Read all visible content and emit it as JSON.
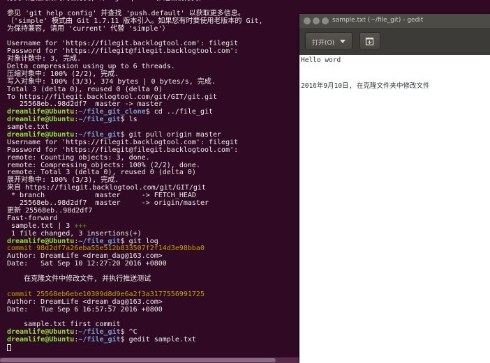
{
  "terminal": {
    "lines": [
      [
        {
          "t": "text",
          "v": "分支到远程无敌的同名分支, 即 'git push' 推送当前分支。"
        }
      ],
      [
        {
          "t": "text",
          "v": ""
        }
      ],
      [
        {
          "t": "text",
          "v": "参见 'git help config' 并查找 'push.default' 以获取更多信息。"
        }
      ],
      [
        {
          "t": "text",
          "v": "（'simple' 模式由 Git 1.7.11 版本引入。如果您有时要使用老版本的 Git,"
        }
      ],
      [
        {
          "t": "text",
          "v": "为保持兼容, 请用 'current' 代替 'simple'）"
        }
      ],
      [
        {
          "t": "text",
          "v": ""
        }
      ],
      [
        {
          "t": "text",
          "v": "Username for 'https://filegit.backlogtool.com': filegit"
        }
      ],
      [
        {
          "t": "text",
          "v": "Password for 'https://filegit@filegit.backlogtool.com':"
        }
      ],
      [
        {
          "t": "text",
          "v": "对象计数中: 3, 完成."
        }
      ],
      [
        {
          "t": "text",
          "v": "Delta compression using up to 6 threads."
        }
      ],
      [
        {
          "t": "text",
          "v": "压缩对象中: 100% (2/2), 完成."
        }
      ],
      [
        {
          "t": "text",
          "v": "写入对象中: 100% (3/3), 374 bytes | 0 bytes/s, 完成."
        }
      ],
      [
        {
          "t": "text",
          "v": "Total 3 (delta 0), reused 0 (delta 0)"
        }
      ],
      [
        {
          "t": "text",
          "v": "To https://filegit.backlogtool.com/git/GIT/git.git"
        }
      ],
      [
        {
          "t": "text",
          "v": "   25568eb..98d2df7  master -> master"
        }
      ],
      [
        {
          "t": "prompt",
          "v": "dreamlife@Ubuntu"
        },
        {
          "t": "sep",
          "v": ":"
        },
        {
          "t": "path",
          "v": "~/file_git_clone"
        },
        {
          "t": "text",
          "v": "$ cd ../file_git"
        }
      ],
      [
        {
          "t": "prompt",
          "v": "dreamlife@Ubuntu"
        },
        {
          "t": "sep",
          "v": ":"
        },
        {
          "t": "path",
          "v": "~/file_git"
        },
        {
          "t": "text",
          "v": "$ ls"
        }
      ],
      [
        {
          "t": "text",
          "v": "sample.txt"
        }
      ],
      [
        {
          "t": "prompt",
          "v": "dreamlife@Ubuntu"
        },
        {
          "t": "sep",
          "v": ":"
        },
        {
          "t": "path",
          "v": "~/file_git"
        },
        {
          "t": "text",
          "v": "$ git pull origin master"
        }
      ],
      [
        {
          "t": "text",
          "v": "Username for 'https://filegit.backlogtool.com': filegit"
        }
      ],
      [
        {
          "t": "text",
          "v": "Password for 'https://filegit@filegit.backlogtool.com':"
        }
      ],
      [
        {
          "t": "text",
          "v": "remote: Counting objects: 3, done."
        }
      ],
      [
        {
          "t": "text",
          "v": "remote: Compressing objects: 100% (2/2), done."
        }
      ],
      [
        {
          "t": "text",
          "v": "remote: Total 3 (delta 0), reused 0 (delta 0)"
        }
      ],
      [
        {
          "t": "text",
          "v": "展开对象中: 100% (3/3), 完成."
        }
      ],
      [
        {
          "t": "text",
          "v": "来自 https://filegit.backlogtool.com/git/GIT/git"
        }
      ],
      [
        {
          "t": "text",
          "v": " * branch            master     -> FETCH_HEAD"
        }
      ],
      [
        {
          "t": "text",
          "v": "   25568eb..98d2df7  master     -> origin/master"
        }
      ],
      [
        {
          "t": "text",
          "v": "更新 25568eb..98d2df7"
        }
      ],
      [
        {
          "t": "text",
          "v": "Fast-forward"
        }
      ],
      [
        {
          "t": "text",
          "v": " sample.txt | 3 "
        },
        {
          "t": "green",
          "v": "+++"
        }
      ],
      [
        {
          "t": "text",
          "v": " 1 file changed, 3 insertions(+)"
        }
      ],
      [
        {
          "t": "prompt",
          "v": "dreamlife@Ubuntu"
        },
        {
          "t": "sep",
          "v": ":"
        },
        {
          "t": "path",
          "v": "~/file_git"
        },
        {
          "t": "text",
          "v": "$ git log"
        }
      ],
      [
        {
          "t": "yellow",
          "v": "commit 98d2df7a26eba55e512b833507f2f14d3e98bba0"
        }
      ],
      [
        {
          "t": "text",
          "v": "Author: DreamLife <dream_dag@163.com>"
        }
      ],
      [
        {
          "t": "text",
          "v": "Date:   Sat Sep 10 12:27:20 2016 +0800"
        }
      ],
      [
        {
          "t": "text",
          "v": ""
        }
      ],
      [
        {
          "t": "text",
          "v": "    在克隆文件中修改文件, 并执行推送测试"
        }
      ],
      [
        {
          "t": "text",
          "v": ""
        }
      ],
      [
        {
          "t": "yellow",
          "v": "commit 25568eb6ebe10309d8d9e6a2f3a3177556991725"
        }
      ],
      [
        {
          "t": "text",
          "v": "Author: DreamLife <dream_dag@163.com>"
        }
      ],
      [
        {
          "t": "text",
          "v": "Date:   Tue Sep 6 16:57:57 2016 +0800"
        }
      ],
      [
        {
          "t": "text",
          "v": ""
        }
      ],
      [
        {
          "t": "text",
          "v": "    sample.txt first commit"
        }
      ],
      [
        {
          "t": "prompt",
          "v": "dreamlife@Ubuntu"
        },
        {
          "t": "sep",
          "v": ":"
        },
        {
          "t": "path",
          "v": "~/file_git"
        },
        {
          "t": "text",
          "v": "$ ^C"
        }
      ],
      [
        {
          "t": "prompt",
          "v": "dreamlife@Ubuntu"
        },
        {
          "t": "sep",
          "v": ":"
        },
        {
          "t": "path",
          "v": "~/file_git"
        },
        {
          "t": "text",
          "v": "$ gedit sample.txt"
        }
      ],
      [
        {
          "t": "cursor",
          "v": ""
        }
      ]
    ]
  },
  "gedit": {
    "window_title": "sample.txt (~/file_git) - gedit",
    "toolbar": {
      "open_label": "打开(O)",
      "open_arrow_icon": "chevron-down-icon",
      "new_tab_icon": "new-document-icon"
    },
    "document": {
      "lines": [
        "Hello word",
        "",
        "",
        "2016年9月10日, 在克隆文件夹中修改文件"
      ]
    }
  },
  "colors": {
    "terminal_bg": "#300a24",
    "terminal_fg": "#eeeeec",
    "prompt_user": "#8ae234",
    "prompt_path": "#729fcf",
    "commit_hash": "#c4a000",
    "diff_plus": "#4e9a06",
    "titlebar": "#4c4b46",
    "toolbar": "#3c3b37"
  }
}
